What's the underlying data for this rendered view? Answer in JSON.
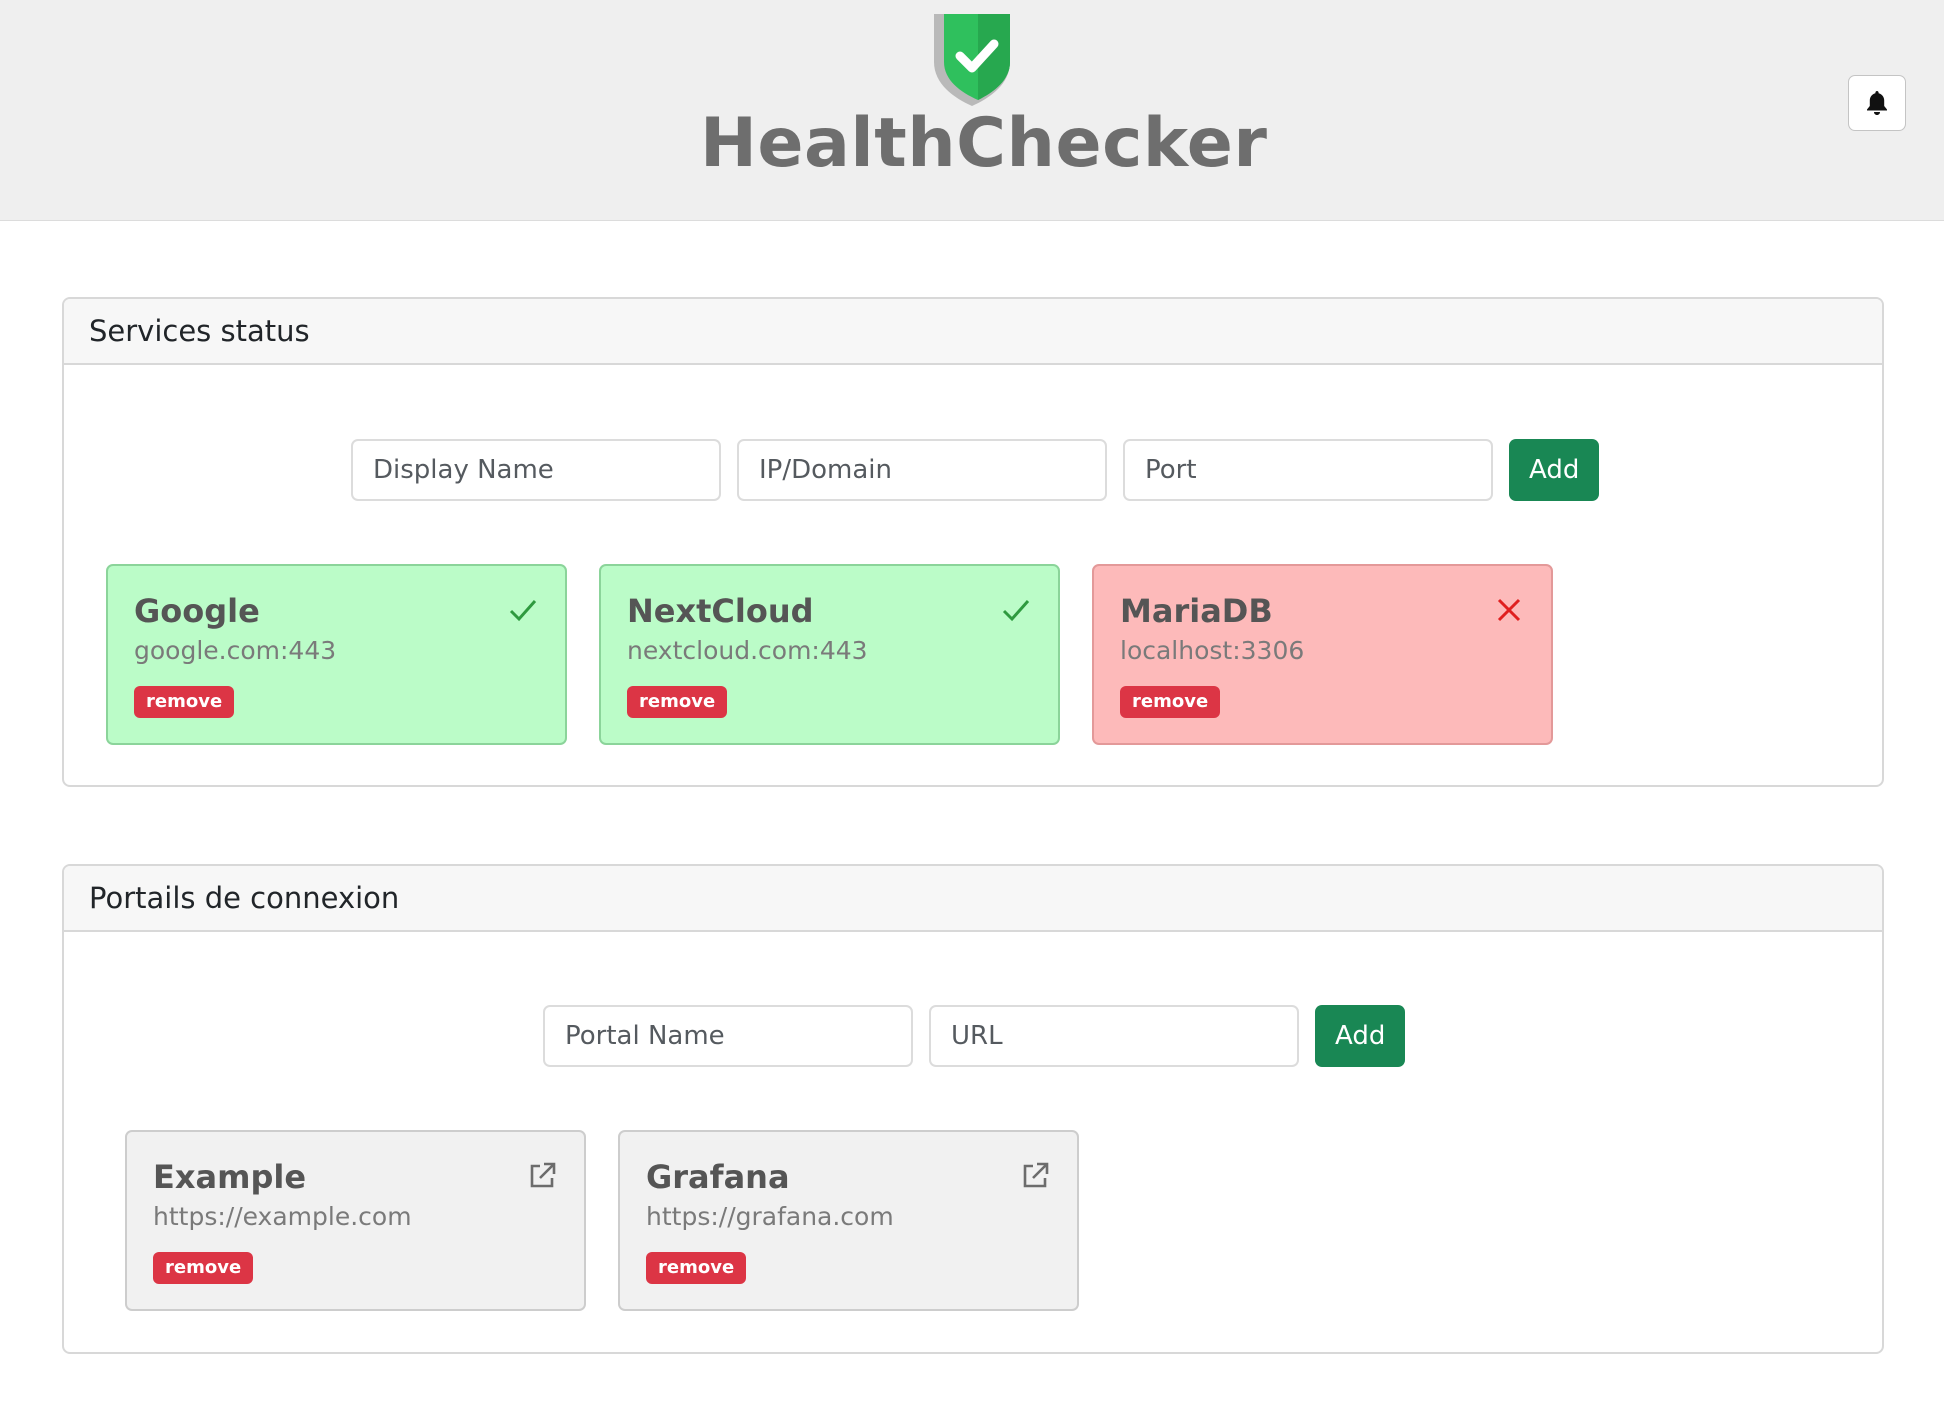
{
  "header": {
    "brand": "HealthChecker",
    "logo_icon": "shield-check-icon",
    "notification_icon": "bell-icon",
    "brand_color": "#2fc05d"
  },
  "services": {
    "title": "Services status",
    "form": {
      "display_name_placeholder": "Display Name",
      "ip_domain_placeholder": "IP/Domain",
      "port_placeholder": "Port",
      "add_label": "Add"
    },
    "items": [
      {
        "name": "Google",
        "address": "google.com:443",
        "status": "up",
        "status_icon": "check-icon",
        "remove_label": "remove"
      },
      {
        "name": "NextCloud",
        "address": "nextcloud.com:443",
        "status": "up",
        "status_icon": "check-icon",
        "remove_label": "remove"
      },
      {
        "name": "MariaDB",
        "address": "localhost:3306",
        "status": "down",
        "status_icon": "cross-icon",
        "remove_label": "remove"
      }
    ],
    "colors": {
      "up": "#bbfcc8",
      "down": "#fdbaba",
      "check": "#2e9a3f",
      "cross": "#e02020"
    }
  },
  "portals": {
    "title": "Portails de connexion",
    "form": {
      "portal_name_placeholder": "Portal Name",
      "url_placeholder": "URL",
      "add_label": "Add"
    },
    "items": [
      {
        "name": "Example",
        "url": "https://example.com",
        "icon": "external-link-icon",
        "remove_label": "remove"
      },
      {
        "name": "Grafana",
        "url": "https://grafana.com",
        "icon": "external-link-icon",
        "remove_label": "remove"
      }
    ]
  },
  "colors": {
    "add_button": "#198754",
    "remove_badge": "#dc3545"
  }
}
